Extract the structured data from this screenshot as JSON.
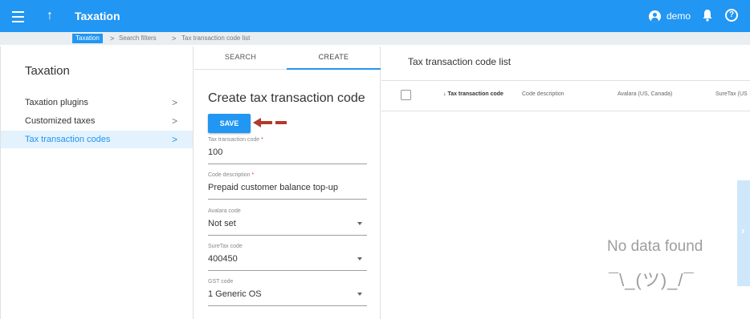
{
  "topbar": {
    "title": "Taxation",
    "up_glyph": "↑",
    "user_name": "demo",
    "help_glyph": "?",
    "menu_icon": "hamburger-menu-icon",
    "user_icon": "account-circle-icon",
    "bell_icon": "notification-bell-icon",
    "help_icon": "help-circle-icon"
  },
  "breadcrumb": {
    "items": [
      "Taxation",
      "Search filters",
      "Tax transaction code list"
    ],
    "separator": ">"
  },
  "sidebar": {
    "title": "Taxation",
    "items": [
      {
        "label": "Taxation plugins",
        "chevron": ">"
      },
      {
        "label": "Customized taxes",
        "chevron": ">"
      },
      {
        "label": "Tax transaction codes",
        "chevron": ">"
      }
    ],
    "active_index": 2
  },
  "form": {
    "tabs": [
      "SEARCH",
      "CREATE"
    ],
    "active_tab": "CREATE",
    "title": "Create tax transaction code",
    "save_label": "SAVE",
    "fields": [
      {
        "label": "Tax transaction code",
        "required_mark": "*",
        "value": "100"
      },
      {
        "label": "Code description",
        "required_mark": "*",
        "value": "Prepaid customer balance top-up"
      },
      {
        "label": "Avalara code",
        "value": "Not set"
      },
      {
        "label": "SureTax code",
        "value": "400450"
      },
      {
        "label": "GST code",
        "value": "1 Generic OS"
      }
    ]
  },
  "list": {
    "title": "Tax transaction code list",
    "columns": [
      "↓ Tax transaction code",
      "Code description",
      "Avalara (US, Canada)",
      "SureTax (US"
    ],
    "empty_text": "No data found",
    "shrug": "¯\\_(ツ)_/¯",
    "expand_glyph": "›"
  },
  "colors": {
    "primary": "#2196f3",
    "annotation_arrow": "#b23a2a",
    "active_item_bg": "#e3f2fd"
  }
}
